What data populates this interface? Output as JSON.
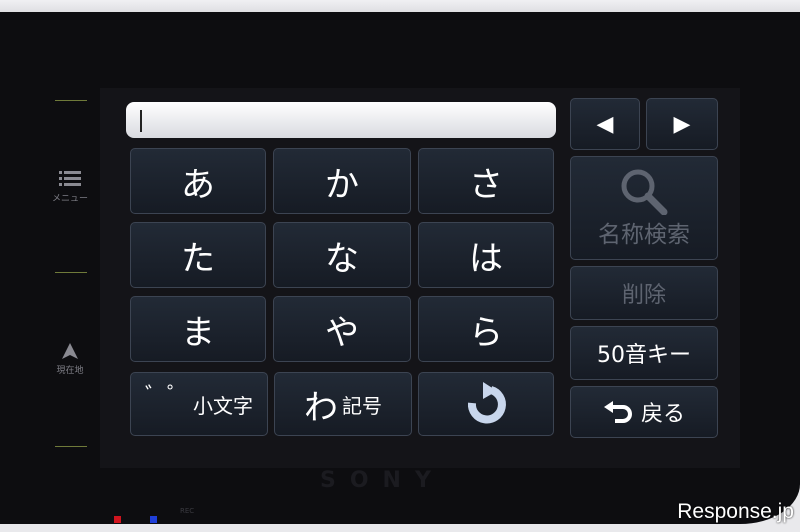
{
  "sidebar": {
    "menu_label": "メニュー",
    "location_label": "現在地"
  },
  "input": {
    "value": ""
  },
  "kana_keys": [
    [
      "あ",
      "か",
      "さ"
    ],
    [
      "た",
      "な",
      "は"
    ],
    [
      "ま",
      "や",
      "ら"
    ]
  ],
  "bottom_keys": {
    "small_char_mark": "゛゜",
    "small_char_label": "小文字",
    "wa": "わ",
    "symbol_label": "記号",
    "rotate_icon": "rotate-icon"
  },
  "side_keys": {
    "left_arrow": "◀",
    "right_arrow": "▶",
    "name_search": "名称検索",
    "delete": "削除",
    "fifty_key": "50音キー",
    "back": "戻る"
  },
  "device": {
    "brand": "SONY"
  },
  "indicators": {
    "rec": "REC"
  },
  "watermark": "Response.jp",
  "colors": {
    "key_bg": "#1d2430",
    "key_border": "#3c4452",
    "disabled_text": "#5e6470",
    "bezel": "#0d0d10"
  }
}
